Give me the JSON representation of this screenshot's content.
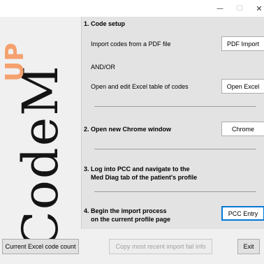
{
  "window": {
    "minimize_glyph": "—",
    "maximize_glyph": "☐",
    "close_glyph": "✕"
  },
  "logo": {
    "main_text": "CodeM",
    "up_text": "UP",
    "up_color": "#f4a16f"
  },
  "steps": {
    "step1": {
      "heading": "1. Code setup",
      "import_label": "Import codes from a PDF file",
      "or_label": "AND/OR",
      "excel_label": "Open and edit Excel table of codes",
      "pdf_button": "PDF Import",
      "excel_button": "Open Excel"
    },
    "step2": {
      "heading": "2. Open new Chrome window",
      "button": "Chrome"
    },
    "step3": {
      "heading_line1": "3. Log into PCC and navigate to the",
      "heading_line2": "Med Diag tab of the patient's profile"
    },
    "step4": {
      "heading_line1": "4. Begin the import process",
      "heading_line2": "on the current profile page",
      "button": "PCC Entry"
    }
  },
  "bottom": {
    "count_button": "Current Excel code count",
    "fail_button": "Copy most recent import fail info",
    "exit_button": "Exit"
  }
}
